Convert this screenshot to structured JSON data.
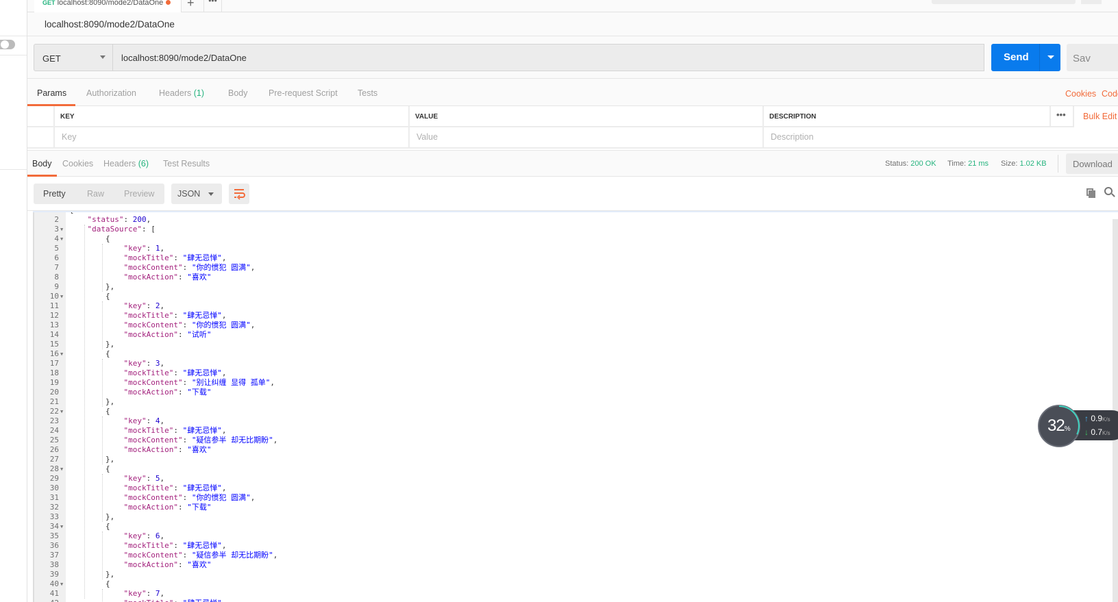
{
  "tab": {
    "method": "GET",
    "title": "localhost:8090/mode2/DataOne",
    "unsaved": true
  },
  "request": {
    "title": "localhost:8090/mode2/DataOne",
    "method": "GET",
    "url": "localhost:8090/mode2/DataOne",
    "send_label": "Send",
    "save_label": "Sav"
  },
  "request_tabs": [
    {
      "label": "Params",
      "active": true
    },
    {
      "label": "Authorization"
    },
    {
      "label": "Headers ",
      "count": "(1)"
    },
    {
      "label": "Body"
    },
    {
      "label": "Pre-request Script"
    },
    {
      "label": "Tests"
    }
  ],
  "links": {
    "cookies": "Cookies",
    "code": "Code",
    "bulk_edit": "Bulk Edit"
  },
  "params_table": {
    "headers": [
      "KEY",
      "VALUE",
      "DESCRIPTION"
    ],
    "placeholders": [
      "Key",
      "Value",
      "Description"
    ]
  },
  "response_tabs": [
    {
      "label": "Body",
      "active": true
    },
    {
      "label": "Cookies"
    },
    {
      "label": "Headers ",
      "count": "(6)"
    },
    {
      "label": "Test Results"
    }
  ],
  "status": {
    "status_label": "Status:",
    "status": "200 OK",
    "time_label": "Time:",
    "time": "21 ms",
    "size_label": "Size:",
    "size": "1.02 KB",
    "download": "Download"
  },
  "view": {
    "modes": [
      "Pretty",
      "Raw",
      "Preview"
    ],
    "active": "Pretty",
    "format": "JSON"
  },
  "code_lines": [
    "{",
    "    \"status\": 200,",
    "    \"dataSource\": [",
    "        {",
    "            \"key\": 1,",
    "            \"mockTitle\": \"肆无忌惮\",",
    "            \"mockContent\": \"你的惯犯 圆满\",",
    "            \"mockAction\": \"喜欢\"",
    "        },",
    "        {",
    "            \"key\": 2,",
    "            \"mockTitle\": \"肆无忌惮\",",
    "            \"mockContent\": \"你的惯犯 圆满\",",
    "            \"mockAction\": \"试听\"",
    "        },",
    "        {",
    "            \"key\": 3,",
    "            \"mockTitle\": \"肆无忌惮\",",
    "            \"mockContent\": \"别让纠缠 显得 孤单\",",
    "            \"mockAction\": \"下载\"",
    "        },",
    "        {",
    "            \"key\": 4,",
    "            \"mockTitle\": \"肆无忌惮\",",
    "            \"mockContent\": \"疑信参半 却无比期盼\",",
    "            \"mockAction\": \"喜欢\"",
    "        },",
    "        {",
    "            \"key\": 5,",
    "            \"mockTitle\": \"肆无忌惮\",",
    "            \"mockContent\": \"你的惯犯 圆满\",",
    "            \"mockAction\": \"下载\"",
    "        },",
    "        {",
    "            \"key\": 6,",
    "            \"mockTitle\": \"肆无忌惮\",",
    "            \"mockContent\": \"疑信参半 却无比期盼\",",
    "            \"mockAction\": \"喜欢\"",
    "        },",
    "        {",
    "            \"key\": 7,",
    "            \"mockTitle\": \"肆无忌惮\","
  ],
  "fold_lines": [
    3,
    4,
    10,
    16,
    22,
    28,
    34,
    40
  ],
  "network_widget": {
    "cpu": "32",
    "cpu_unit": "%",
    "up": "0.9",
    "down": "0.7",
    "unit": "K/s"
  },
  "colors": {
    "accent": "#f26b3a",
    "send": "#097bed",
    "success": "#26b47f"
  }
}
